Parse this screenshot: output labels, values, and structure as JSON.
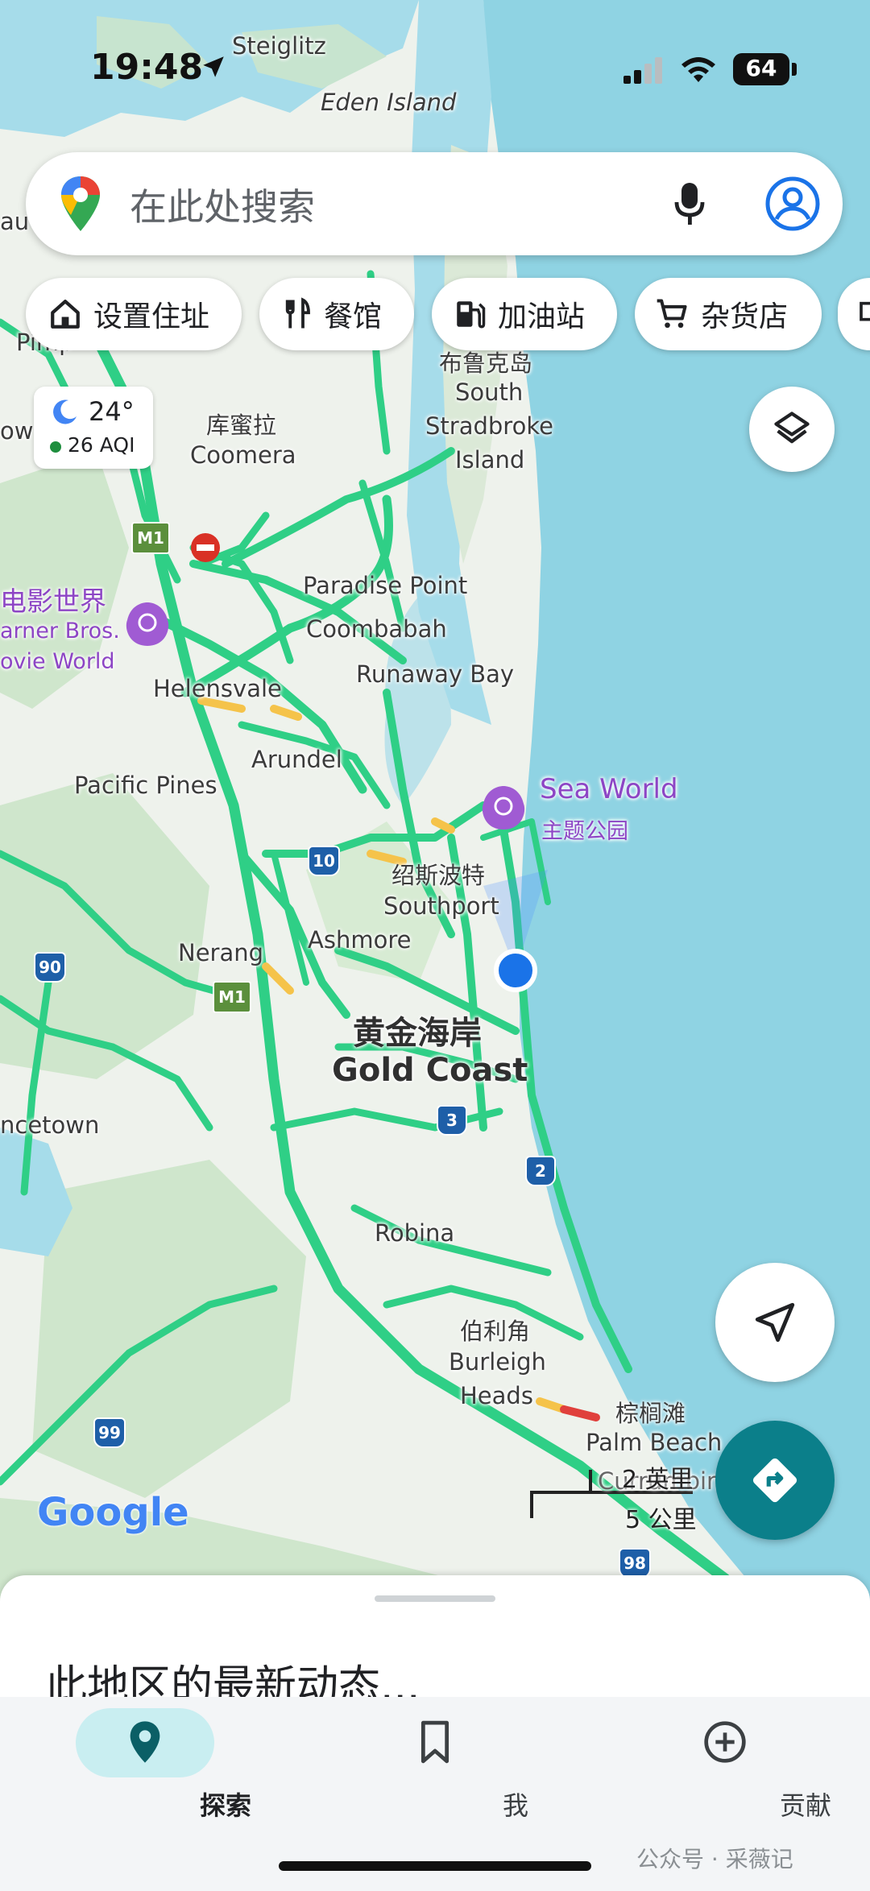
{
  "status_bar": {
    "time": "19:48",
    "battery": "64"
  },
  "search": {
    "placeholder": "在此处搜索"
  },
  "chips": [
    {
      "label": "设置住址",
      "icon": "home-icon"
    },
    {
      "label": "餐馆",
      "icon": "restaurant-icon"
    },
    {
      "label": "加油站",
      "icon": "gas-station-icon"
    },
    {
      "label": "杂货店",
      "icon": "cart-icon"
    }
  ],
  "weather": {
    "temp": "24°",
    "aqi": "26 AQI"
  },
  "map": {
    "labels": {
      "steiglitz": "Steiglitz",
      "eden_island": "Eden Island",
      "au": "au",
      "pimpama": "Pimp",
      "ow": "ow V",
      "bribie_cn": "布鲁克岛",
      "south": "South",
      "stradbroke": "Stradbroke",
      "island": "Island",
      "coomera_cn": "库蜜拉",
      "coomera": "Coomera",
      "paradise_point": "Paradise Point",
      "coombabah": "Coombabah",
      "runaway_bay": "Runaway Bay",
      "movie_world_cn": "电影世界",
      "warner_bros": "arner Bros.",
      "movie_world": "ovie World",
      "helensvale": "Helensvale",
      "arundel": "Arundel",
      "pacific_pines": "Pacific Pines",
      "sea_world": "Sea World",
      "theme_park": "主题公园",
      "southport_cn": "绍斯波特",
      "southport": "Southport",
      "ashmore": "Ashmore",
      "nerang": "Nerang",
      "gold_coast_cn": "黄金海岸",
      "gold_coast": "Gold Coast",
      "cetown": "ncetown",
      "robina": "Robina",
      "burleigh_cn": "伯利角",
      "burleigh": "Burleigh",
      "heads": "Heads",
      "palm_beach_cn": "棕榈滩",
      "palm_beach": "Palm Beach",
      "currumbin": "Currumbin"
    },
    "road_shields": {
      "m1_top": "M1",
      "m1_mid": "M1",
      "r10": "10",
      "r90": "90",
      "r3": "3",
      "r2": "2",
      "r99": "99",
      "r98": "98"
    },
    "google_logo": "Google",
    "scale": {
      "imperial": "2 英里",
      "metric": "5 公里"
    }
  },
  "sheet": {
    "title": "此地区的最新动态..."
  },
  "nav": [
    {
      "label": "探索",
      "icon": "explore-pin-icon",
      "active": true
    },
    {
      "label": "我",
      "icon": "bookmark-icon",
      "active": false
    },
    {
      "label": "贡献",
      "icon": "add-circle-icon",
      "active": false
    }
  ],
  "watermark": "公众号 · 采薇记",
  "colors": {
    "traffic": "#2fcf86",
    "water": "#8fd3e3",
    "accent": "#0b7f8a",
    "location": "#1a73e8",
    "poi": "#a05bd3"
  }
}
